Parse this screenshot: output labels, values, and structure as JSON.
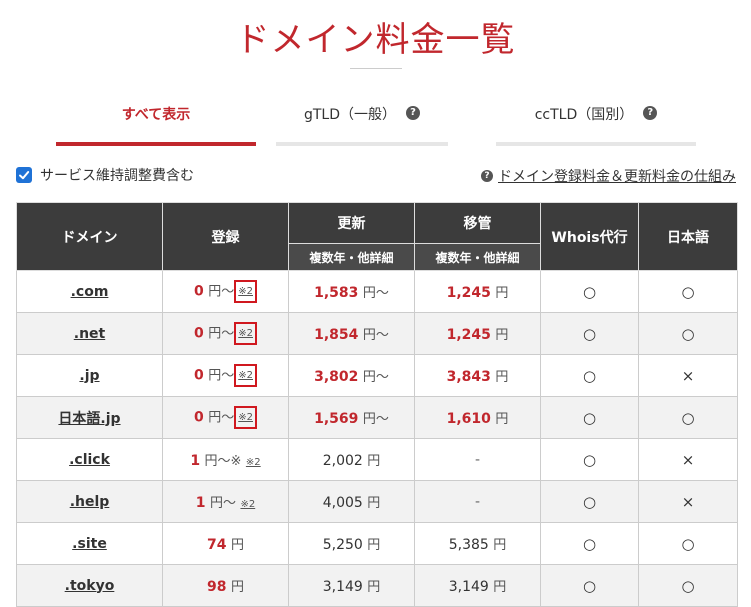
{
  "page": {
    "title": "ドメイン料金一覧"
  },
  "tabs": [
    {
      "label": "すべて表示",
      "active": true,
      "help": false
    },
    {
      "label": "gTLD（一般）",
      "active": false,
      "help": true
    },
    {
      "label": "ccTLD（国別）",
      "active": false,
      "help": true
    }
  ],
  "options": {
    "include_service_fee_label": "サービス維持調整費含む",
    "include_service_fee_checked": true,
    "help_link_label": "ドメイン登録料金＆更新料金の仕組み"
  },
  "table": {
    "headers": {
      "domain": "ドメイン",
      "register": "登録",
      "renew": "更新",
      "renew_sub": "複数年・他詳細",
      "transfer": "移管",
      "transfer_sub": "複数年・他詳細",
      "whois": "Whois代行",
      "japanese": "日本語"
    },
    "rows": [
      {
        "domain": ".com",
        "register": "0",
        "reg_unit": "円〜",
        "reg_note": "※2",
        "reg_note_boxed": true,
        "renew": "1,583",
        "renew_unit": "円〜",
        "renew_red": true,
        "transfer": "1,245",
        "transfer_unit": "円",
        "transfer_red": true,
        "whois": "○",
        "japanese": "○"
      },
      {
        "domain": ".net",
        "register": "0",
        "reg_unit": "円〜",
        "reg_note": "※2",
        "reg_note_boxed": true,
        "renew": "1,854",
        "renew_unit": "円〜",
        "renew_red": true,
        "transfer": "1,245",
        "transfer_unit": "円",
        "transfer_red": true,
        "whois": "○",
        "japanese": "○"
      },
      {
        "domain": ".jp",
        "register": "0",
        "reg_unit": "円〜",
        "reg_note": "※2",
        "reg_note_boxed": true,
        "renew": "3,802",
        "renew_unit": "円〜",
        "renew_red": true,
        "transfer": "3,843",
        "transfer_unit": "円",
        "transfer_red": true,
        "whois": "○",
        "japanese": "×"
      },
      {
        "domain": "日本語.jp",
        "register": "0",
        "reg_unit": "円〜",
        "reg_note": "※2",
        "reg_note_boxed": true,
        "renew": "1,569",
        "renew_unit": "円〜",
        "renew_red": true,
        "transfer": "1,610",
        "transfer_unit": "円",
        "transfer_red": true,
        "whois": "○",
        "japanese": "○"
      },
      {
        "domain": ".click",
        "register": "1",
        "reg_unit": "円〜※",
        "reg_note": "※2",
        "reg_note_boxed": false,
        "renew": "2,002",
        "renew_unit": "円",
        "renew_red": false,
        "transfer": "-",
        "transfer_unit": "",
        "transfer_red": false,
        "whois": "○",
        "japanese": "×"
      },
      {
        "domain": ".help",
        "register": "1",
        "reg_unit": "円〜",
        "reg_note": "※2",
        "reg_note_boxed": false,
        "renew": "4,005",
        "renew_unit": "円",
        "renew_red": false,
        "transfer": "-",
        "transfer_unit": "",
        "transfer_red": false,
        "whois": "○",
        "japanese": "×"
      },
      {
        "domain": ".site",
        "register": "74",
        "reg_unit": "円",
        "reg_note": "",
        "reg_note_boxed": false,
        "renew": "5,250",
        "renew_unit": "円",
        "renew_red": false,
        "transfer": "5,385",
        "transfer_unit": "円",
        "transfer_red": false,
        "whois": "○",
        "japanese": "○"
      },
      {
        "domain": ".tokyo",
        "register": "98",
        "reg_unit": "円",
        "reg_note": "",
        "reg_note_boxed": false,
        "renew": "3,149",
        "renew_unit": "円",
        "renew_red": false,
        "transfer": "3,149",
        "transfer_unit": "円",
        "transfer_red": false,
        "whois": "○",
        "japanese": "○"
      }
    ]
  },
  "colors": {
    "accent": "#c1272d",
    "header_bg": "#3c3c3c",
    "checkbox": "#1f72d6",
    "highlight_box": "#d0181f"
  }
}
